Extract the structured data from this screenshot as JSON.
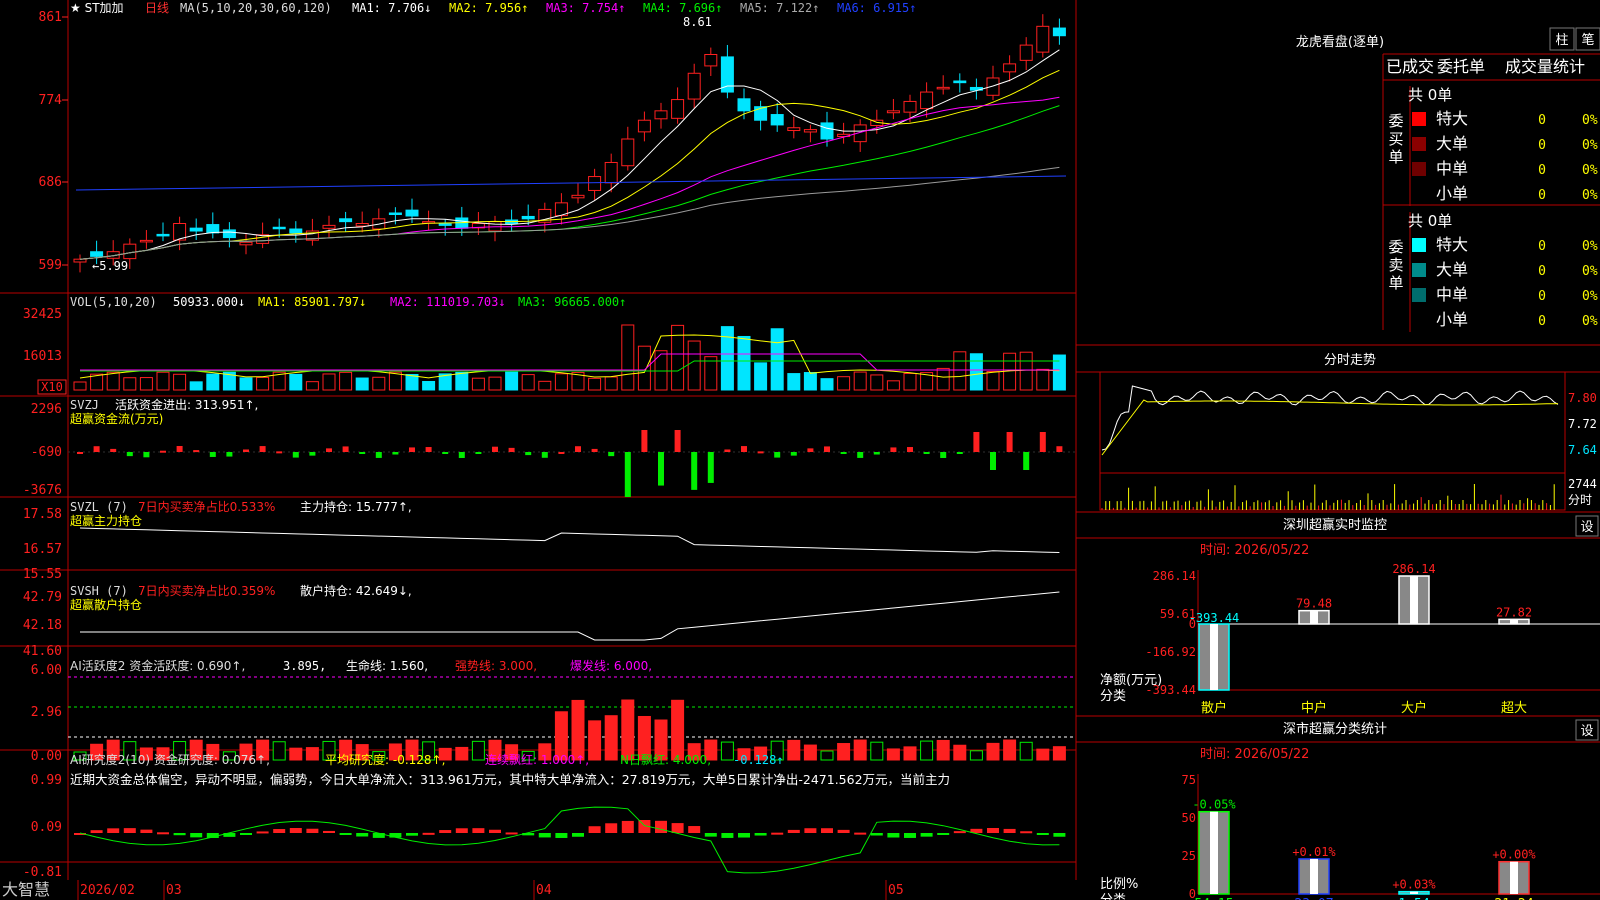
{
  "colors": {
    "up": "#ff2020",
    "down": "#00e5ff",
    "green": "#00ee00",
    "frame": "#b80000",
    "white": "#ffffff",
    "yellow": "#ffff00",
    "magenta": "#ff00ff",
    "blue": "#2040ff",
    "gray": "#9a9a9a"
  },
  "kline": {
    "header_prefix": "★ ST加加",
    "period": "日线",
    "ma_title": "MA(5,10,20,30,60,120)",
    "ma_values": [
      {
        "label": "MA1: 7.706↓",
        "color": "#ffffff"
      },
      {
        "label": "MA2: 7.956↑",
        "color": "#ffff00"
      },
      {
        "label": "MA3: 7.754↑",
        "color": "#ff00ff"
      },
      {
        "label": "MA4: 7.696↑",
        "color": "#00ee00"
      },
      {
        "label": "MA5: 7.122↑",
        "color": "#aaaaaa"
      },
      {
        "label": "MA6: 6.915↑",
        "color": "#2040ff"
      }
    ],
    "y_ticks": [
      "861",
      "774",
      "686",
      "599"
    ],
    "high_label": "8.61",
    "low_label": "←5.99"
  },
  "vol": {
    "title": "VOL(5,10,20)",
    "value": "50933.000↓",
    "ma1": "MA1: 85901.797↓",
    "ma2": "MA2: 111019.703↓",
    "ma3": "MA3: 96665.000↑",
    "y_ticks": [
      "32425",
      "16013"
    ],
    "unit": "X10"
  },
  "svzj": {
    "title": "SVZJ",
    "label": "活跃资金进出: 313.951↑,",
    "sub": "超赢资金流(万元)",
    "y_ticks": [
      "2296",
      "-690",
      "-3676"
    ]
  },
  "svzl": {
    "title": "SVZL (7)",
    "ratio": "7日内买卖净占比0.533%",
    "hold": "主力持仓: 15.777↑,",
    "sub": "超赢主力持仓",
    "y_ticks": [
      "17.58",
      "16.57",
      "15.55"
    ]
  },
  "svsh": {
    "title": "SVSH (7)",
    "ratio": "7日内买卖净占比0.359%",
    "hold": "散户持仓: 42.649↓,",
    "sub": "超赢散户持仓",
    "y_ticks": [
      "42.79",
      "42.18",
      "41.60"
    ]
  },
  "ai1": {
    "title": "AI活跃度2 资金活跃度: 0.690↑,",
    "v2": "3.895,",
    "life": "生命线: 1.560,",
    "strong": "强势线: 3.000,",
    "burst": "爆发线: 6.000,",
    "y_ticks": [
      "6.00",
      "2.96",
      "0.00"
    ]
  },
  "ai2": {
    "title": "AI研究度2(10) 资金研究度: 0.076↑,",
    "avg": "平均研究度: -0.128↑,",
    "lian": "连续飘红: 1.000↑,",
    "n": "N日飘红: 4.000,",
    "last": "-0.128↑",
    "commentary": "近期大资金总体偏空，异动不明显，偏弱势，今日大单净流入：313.961万元，其中特大单净流入：27.819万元，大单5日累计净出-2471.562万元，当前主力",
    "y_ticks": [
      "0.99",
      "0.09",
      "-0.81"
    ]
  },
  "footer": {
    "brand": "大智慧",
    "dates": [
      "2026/02",
      "03",
      "04",
      "05"
    ]
  },
  "longhu": {
    "title": "龙虎看盘(逐单)",
    "btn1": "柱",
    "btn2": "笔",
    "tabs": [
      "已成交",
      "委托单",
      "成交量统计"
    ],
    "buy": {
      "side_label": "委买单",
      "total": "共 0单",
      "rows": [
        {
          "name": "特大",
          "n": "0",
          "pct": "0%",
          "color": "#ff0000"
        },
        {
          "name": "大单",
          "n": "0",
          "pct": "0%",
          "color": "#8b0000"
        },
        {
          "name": "中单",
          "n": "0",
          "pct": "0%",
          "color": "#700000"
        },
        {
          "name": "小单",
          "n": "0",
          "pct": "0%",
          "color": "#000000"
        }
      ]
    },
    "sell": {
      "side_label": "委卖单",
      "total": "共 0单",
      "rows": [
        {
          "name": "特大",
          "n": "0",
          "pct": "0%",
          "color": "#00ffff"
        },
        {
          "name": "大单",
          "n": "0",
          "pct": "0%",
          "color": "#008b8b"
        },
        {
          "name": "中单",
          "n": "0",
          "pct": "0%",
          "color": "#006d6d"
        },
        {
          "name": "小单",
          "n": "0",
          "pct": "0%",
          "color": "#000000"
        }
      ]
    }
  },
  "intraday": {
    "title": "分时走势",
    "y_ticks": [
      "7.80",
      "7.72",
      "7.64"
    ],
    "vol_label": "2744",
    "vol_unit": "分时"
  },
  "szmon": {
    "title": "深圳超赢实时监控",
    "btn": "设",
    "time": "时间: 2026/05/22",
    "y_ticks": [
      "286.14",
      "59.61",
      "0",
      "-166.92",
      "-393.44"
    ],
    "ylabel": "净额(万元)",
    "xlabel": "分类",
    "categories": [
      "散户",
      "中户",
      "大户",
      "超大"
    ],
    "values": [
      -393.44,
      79.48,
      286.14,
      27.82
    ],
    "labels": [
      "-393.44",
      "79.48",
      "286.14",
      "27.82"
    ]
  },
  "szstat": {
    "title": "深市超赢分类统计",
    "btn": "设",
    "time": "时间: 2026/05/22",
    "y_ticks": [
      "75",
      "50",
      "25",
      "0"
    ],
    "ylabel": "比例%",
    "xlabel": "分类",
    "categories": [
      "散户",
      "中户",
      "大户",
      "超大"
    ],
    "values": [
      54.15,
      23.07,
      1.54,
      21.24
    ],
    "changes": [
      "-0.05%",
      "+0.01%",
      "+0.03%",
      "+0.00%"
    ],
    "labels": [
      "54.15",
      "23.07",
      "1.54",
      "21.24"
    ]
  },
  "chart_data": [
    {
      "type": "bar",
      "title": "深圳超赢实时监控",
      "ylabel": "净额(万元)",
      "xlabel": "分类",
      "categories": [
        "散户",
        "中户",
        "大户",
        "超大"
      ],
      "values": [
        -393.44,
        79.48,
        286.14,
        27.82
      ],
      "ylim": [
        -393.44,
        286.14
      ]
    },
    {
      "type": "bar",
      "title": "深市超赢分类统计",
      "ylabel": "比例%",
      "xlabel": "分类",
      "categories": [
        "散户",
        "中户",
        "大户",
        "超大"
      ],
      "values": [
        54.15,
        23.07,
        1.54,
        21.24
      ],
      "ylim": [
        0,
        75
      ]
    }
  ]
}
